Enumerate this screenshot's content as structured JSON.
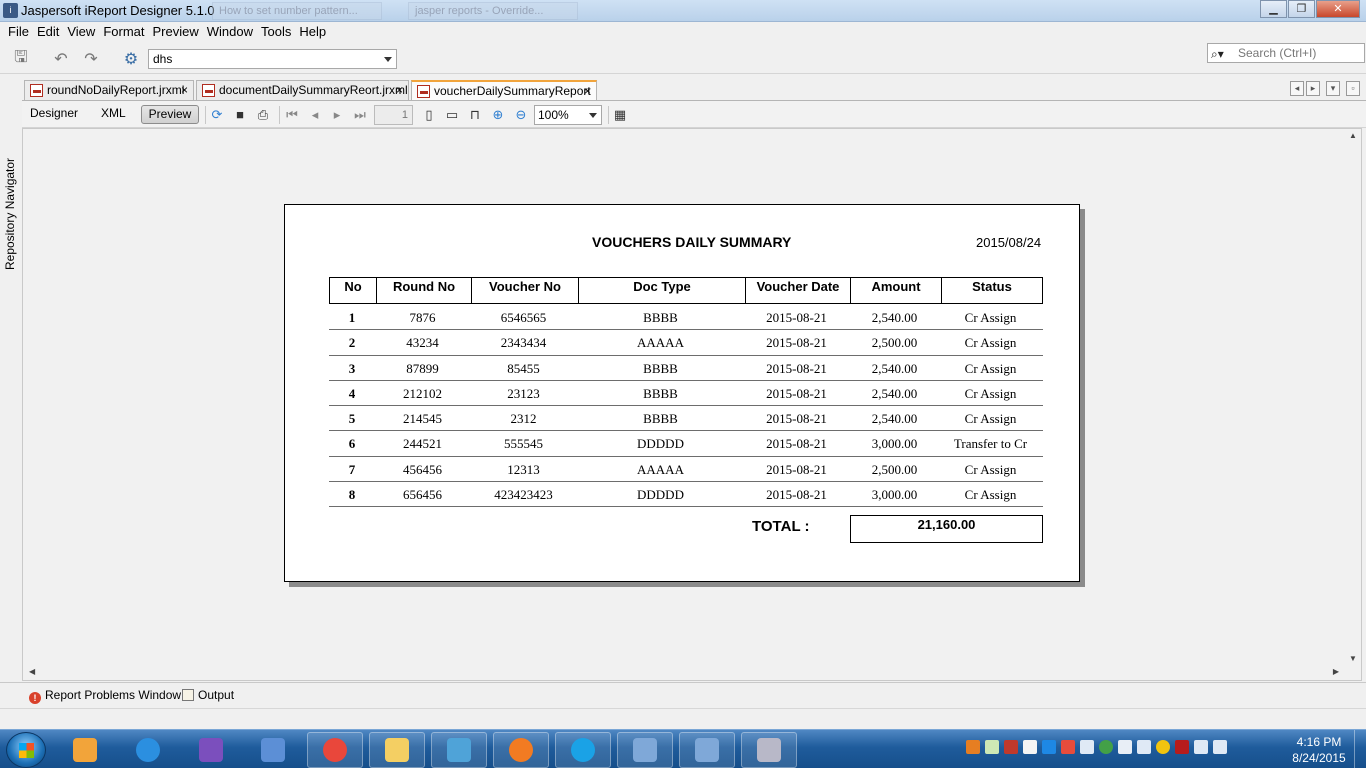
{
  "window": {
    "title": "Jaspersoft iReport Designer 5.1.0",
    "background_tabs": [
      "How to set number pattern...",
      "jasper reports - Override..."
    ],
    "controls": [
      "minimize",
      "maximize",
      "close"
    ]
  },
  "menu": [
    "File",
    "Edit",
    "View",
    "Format",
    "Preview",
    "Window",
    "Tools",
    "Help"
  ],
  "toolbar": {
    "datasource_value": "dhs",
    "search_placeholder": "Search (Ctrl+I)"
  },
  "left_strip": {
    "label": "Repository Navigator"
  },
  "editor_tabs": [
    {
      "label": "roundNoDailyReport.jrxml",
      "active": false
    },
    {
      "label": "documentDailySummaryReort.jrxml",
      "active": false
    },
    {
      "label": "voucherDailySummaryReport",
      "active": true
    }
  ],
  "editor_toolbar": {
    "designer_label": "Designer",
    "xml_label": "XML",
    "preview_label": "Preview",
    "page_number": "1",
    "zoom": "100%"
  },
  "report": {
    "title": "VOUCHERS DAILY SUMMARY",
    "date": "2015/08/24",
    "columns": [
      "No",
      "Round No",
      "Voucher No",
      "Doc Type",
      "Voucher Date",
      "Amount",
      "Status"
    ],
    "rows": [
      [
        "1",
        "7876",
        "6546565",
        "BBBB",
        "2015-08-21",
        "2,540.00",
        "Cr Assign"
      ],
      [
        "2",
        "43234",
        "2343434",
        "AAAAA",
        "2015-08-21",
        "2,500.00",
        "Cr Assign"
      ],
      [
        "3",
        "87899",
        "85455",
        "BBBB",
        "2015-08-21",
        "2,540.00",
        "Cr Assign"
      ],
      [
        "4",
        "212102",
        "23123",
        "BBBB",
        "2015-08-21",
        "2,540.00",
        "Cr Assign"
      ],
      [
        "5",
        "214545",
        "2312",
        "BBBB",
        "2015-08-21",
        "2,540.00",
        "Cr Assign"
      ],
      [
        "6",
        "244521",
        "555545",
        "DDDDD",
        "2015-08-21",
        "3,000.00",
        "Transfer to Cr"
      ],
      [
        "7",
        "456456",
        "12313",
        "AAAAA",
        "2015-08-21",
        "2,500.00",
        "Cr Assign"
      ],
      [
        "8",
        "656456",
        "423423423",
        "DDDDD",
        "2015-08-21",
        "3,000.00",
        "Cr Assign"
      ]
    ],
    "total_label": "TOTAL :",
    "total_value": "21,160.00"
  },
  "bottom_panel": {
    "problems_label": "Report Problems Window",
    "output_label": "Output"
  },
  "taskbar": {
    "time": "4:16 PM",
    "date": "8/24/2015",
    "apps": [
      "media-player",
      "internet-explorer",
      "visual-studio",
      "remote-desktop",
      "chrome",
      "file-explorer",
      "control-panel",
      "firefox",
      "skype",
      "virtualbox",
      "virtualbox",
      "ireport"
    ]
  }
}
